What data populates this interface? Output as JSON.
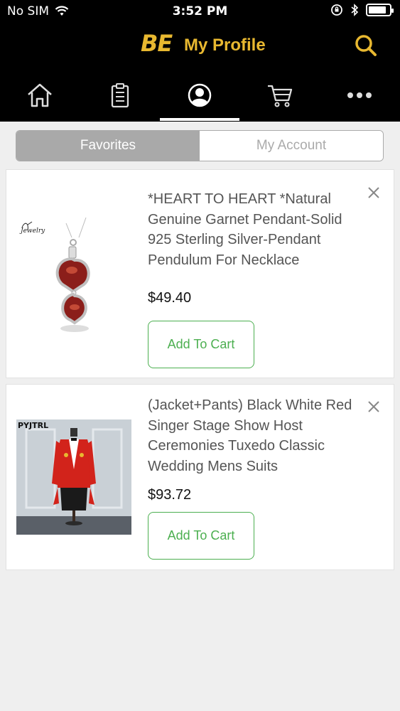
{
  "status_bar": {
    "carrier": "No SIM",
    "time": "3:52 PM"
  },
  "header": {
    "brand": "BE",
    "title": "My Profile"
  },
  "tabs": [
    {
      "name": "home-icon"
    },
    {
      "name": "orders-icon"
    },
    {
      "name": "profile-icon",
      "active": true
    },
    {
      "name": "cart-icon"
    },
    {
      "name": "more-icon"
    }
  ],
  "segments": {
    "favorites": "Favorites",
    "my_account": "My Account",
    "active": "favorites"
  },
  "favorites": [
    {
      "thumb_label": "Jewelry",
      "title": "*HEART TO HEART *Natural Genuine Garnet Pendant-Solid 925 Sterling Silver-Pendant Pendulum For Necklace",
      "price": "$49.40",
      "button": "Add To Cart"
    },
    {
      "thumb_label": "PYJTRL",
      "title": "(Jacket+Pants) Black White Red Singer Stage Show Host Ceremonies Tuxedo Classic Wedding Mens Suits",
      "price": "$93.72",
      "button": "Add To Cart"
    }
  ],
  "colors": {
    "header_bg": "#000000",
    "brand": "#e8b830",
    "accent_green": "#4caf50",
    "segment_active": "#a9a9a9"
  }
}
